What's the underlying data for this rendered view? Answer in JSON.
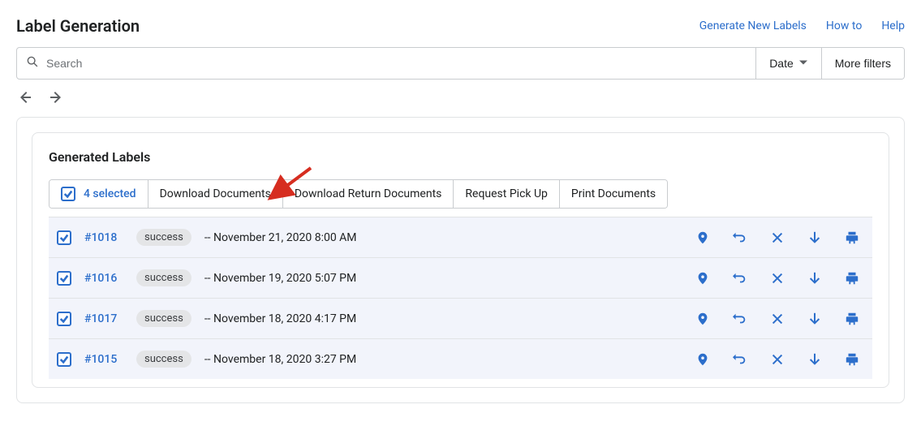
{
  "header": {
    "title": "Label Generation",
    "links": {
      "generate": "Generate New Labels",
      "howto": "How to",
      "help": "Help"
    }
  },
  "filters": {
    "search_placeholder": "Search",
    "date_label": "Date",
    "more_filters": "More filters"
  },
  "section": {
    "title": "Generated Labels",
    "selected_label": "4 selected",
    "bulk_actions": {
      "download_docs": "Download Documents",
      "download_return": "Download Return Documents",
      "request_pickup": "Request Pick Up",
      "print_docs": "Print Documents"
    }
  },
  "rows": [
    {
      "id": "#1018",
      "status": "success",
      "date_prefix": "--",
      "date": "November 21, 2020 8:00 AM",
      "checked": true
    },
    {
      "id": "#1016",
      "status": "success",
      "date_prefix": "--",
      "date": "November 19, 2020 5:07 PM",
      "checked": true
    },
    {
      "id": "#1017",
      "status": "success",
      "date_prefix": "--",
      "date": "November 18, 2020 4:17 PM",
      "checked": true
    },
    {
      "id": "#1015",
      "status": "success",
      "date_prefix": "--",
      "date": "November 18, 2020 3:27 PM",
      "checked": true
    }
  ],
  "row_action_icons": [
    "location-pin-icon",
    "return-icon",
    "cancel-icon",
    "download-icon",
    "print-icon"
  ],
  "colors": {
    "link": "#2c6ecb",
    "annotation": "#d62d20"
  }
}
